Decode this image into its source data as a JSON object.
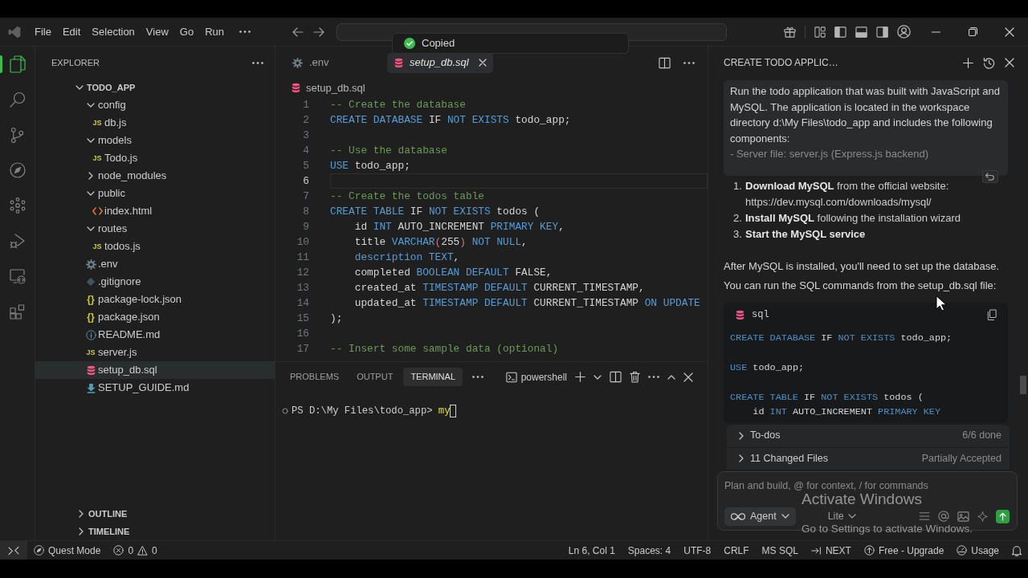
{
  "title_bar": {
    "menus": [
      "File",
      "Edit",
      "Selection",
      "View",
      "Go",
      "Run"
    ],
    "toast": "Copied"
  },
  "activity_bar": [
    {
      "selected": true
    },
    {
      "selected": false
    },
    {
      "selected": false
    },
    {
      "selected": false
    },
    {
      "selected": false
    },
    {
      "selected": false
    },
    {
      "selected": false
    },
    {
      "selected": false
    }
  ],
  "explorer": {
    "title": "EXPLORER",
    "tree": {
      "label": "TODO_APP",
      "expanded": true,
      "children": [
        {
          "label": "config",
          "kind": "folder",
          "expanded": true,
          "selected": false,
          "children": [
            {
              "label": "db.js",
              "kind": "javascript",
              "badge": "JS",
              "selected": false
            }
          ]
        },
        {
          "label": "models",
          "kind": "folder",
          "expanded": true,
          "selected": false,
          "children": [
            {
              "label": "Todo.js",
              "kind": "javascript",
              "badge": "JS",
              "selected": false
            }
          ]
        },
        {
          "label": "node_modules",
          "kind": "folder",
          "expanded": false,
          "selected": false
        },
        {
          "label": "public",
          "kind": "folder",
          "expanded": true,
          "selected": false,
          "children": [
            {
              "label": "index.html",
              "kind": "html",
              "selected": false
            }
          ]
        },
        {
          "label": "routes",
          "kind": "folder",
          "expanded": true,
          "selected": false,
          "children": [
            {
              "label": "todos.js",
              "kind": "javascript",
              "badge": "JS",
              "selected": false
            }
          ]
        },
        {
          "label": ".env",
          "kind": "env",
          "selected": false
        },
        {
          "label": ".gitignore",
          "kind": "gitignore",
          "selected": false
        },
        {
          "label": "package-lock.json",
          "kind": "json",
          "badge": "{}",
          "selected": false
        },
        {
          "label": "package.json",
          "kind": "json",
          "badge": "{}",
          "selected": false
        },
        {
          "label": "README.md",
          "kind": "readme",
          "selected": false
        },
        {
          "label": "server.js",
          "kind": "javascript",
          "badge": "JS",
          "selected": false
        },
        {
          "label": "setup_db.sql",
          "kind": "sql",
          "selected": true
        },
        {
          "label": "SETUP_GUIDE.md",
          "kind": "markdown",
          "selected": false
        }
      ]
    },
    "sections": [
      {
        "label": "OUTLINE",
        "expanded": false
      },
      {
        "label": "TIMELINE",
        "expanded": false
      }
    ]
  },
  "editor": {
    "tabs": [
      {
        "label": ".env",
        "kind": "env",
        "selected": false,
        "preview": false
      },
      {
        "label": "setup_db.sql",
        "kind": "sql",
        "selected": true,
        "preview": true
      }
    ],
    "breadcrumb": "setup_db.sql",
    "lines": [
      {
        "number": "1",
        "current": false,
        "tokens": [
          {
            "kind": "comment",
            "text": "-- Create the database"
          }
        ]
      },
      {
        "number": "2",
        "current": false,
        "tokens": [
          {
            "kind": "keyword",
            "text": "CREATE DATABASE"
          },
          {
            "kind": "plain",
            "text": " IF "
          },
          {
            "kind": "keyword",
            "text": "NOT EXISTS"
          },
          {
            "kind": "plain",
            "text": " todo_app;"
          }
        ]
      },
      {
        "number": "3",
        "current": false
      },
      {
        "number": "4",
        "current": false,
        "tokens": [
          {
            "kind": "comment",
            "text": "-- Use the database"
          }
        ]
      },
      {
        "number": "5",
        "current": false,
        "tokens": [
          {
            "kind": "keyword",
            "text": "USE"
          },
          {
            "kind": "plain",
            "text": " todo_app;"
          }
        ]
      },
      {
        "number": "6",
        "current": true
      },
      {
        "number": "7",
        "current": false,
        "tokens": [
          {
            "kind": "comment",
            "text": "-- Create the todos table"
          }
        ]
      },
      {
        "number": "8",
        "current": false,
        "tokens": [
          {
            "kind": "keyword",
            "text": "CREATE TABLE"
          },
          {
            "kind": "plain",
            "text": " IF "
          },
          {
            "kind": "keyword",
            "text": "NOT EXISTS"
          },
          {
            "kind": "plain",
            "text": " todos ("
          }
        ]
      },
      {
        "number": "9",
        "current": false,
        "tokens": [
          {
            "kind": "plain",
            "text": "    id "
          },
          {
            "kind": "keyword",
            "text": "INT"
          },
          {
            "kind": "plain",
            "text": " AUTO_INCREMENT "
          },
          {
            "kind": "keyword",
            "text": "PRIMARY KEY"
          },
          {
            "kind": "plain",
            "text": ","
          }
        ]
      },
      {
        "number": "10",
        "current": false,
        "tokens": [
          {
            "kind": "plain",
            "text": "    title "
          },
          {
            "kind": "keyword",
            "text": "VARCHAR"
          },
          {
            "kind": "bracket",
            "text": "("
          },
          {
            "kind": "plain",
            "text": "255"
          },
          {
            "kind": "bracket",
            "text": ")"
          },
          {
            "kind": "keyword",
            "text": " NOT NULL"
          },
          {
            "kind": "plain",
            "text": ","
          }
        ]
      },
      {
        "number": "11",
        "current": false,
        "tokens": [
          {
            "kind": "keyword",
            "text": "    description TEXT"
          },
          {
            "kind": "plain",
            "text": ","
          }
        ]
      },
      {
        "number": "12",
        "current": false,
        "tokens": [
          {
            "kind": "plain",
            "text": "    completed "
          },
          {
            "kind": "keyword",
            "text": "BOOLEAN DEFAULT"
          },
          {
            "kind": "plain",
            "text": " FALSE,"
          }
        ]
      },
      {
        "number": "13",
        "current": false,
        "tokens": [
          {
            "kind": "plain",
            "text": "    created_at "
          },
          {
            "kind": "keyword",
            "text": "TIMESTAMP DEFAULT"
          },
          {
            "kind": "plain",
            "text": " CURRENT_TIMESTAMP,"
          }
        ]
      },
      {
        "number": "14",
        "current": false,
        "tokens": [
          {
            "kind": "plain",
            "text": "    updated_at "
          },
          {
            "kind": "keyword",
            "text": "TIMESTAMP DEFAULT"
          },
          {
            "kind": "plain",
            "text": " CURRENT_TIMESTAMP "
          },
          {
            "kind": "keyword",
            "text": "ON UPDATE"
          }
        ]
      },
      {
        "number": "15",
        "current": false,
        "tokens": [
          {
            "kind": "plain",
            "text": ");"
          }
        ]
      },
      {
        "number": "16",
        "current": false
      },
      {
        "number": "17",
        "current": false,
        "tokens": [
          {
            "kind": "comment",
            "text": "-- Insert some sample data (optional)"
          }
        ]
      }
    ]
  },
  "panel": {
    "tabs": [
      {
        "label": "PROBLEMS",
        "selected": false
      },
      {
        "label": "OUTPUT",
        "selected": false
      },
      {
        "label": "TERMINAL",
        "selected": true
      }
    ],
    "shell": "powershell",
    "prompt": "PS D:\\My Files\\todo_app> ",
    "input": "my"
  },
  "chat": {
    "title": "CREATE TODO APPLIC…",
    "message": {
      "text": "Run the todo application that was built with JavaScript and MySQL. The application is located in the workspace directory d:\\My Files\\todo_app and includes the following components:",
      "excerpt": "- Server file: server.js (Express.js backend)"
    },
    "steps": [
      {
        "number": "1.",
        "text": "**Download MySQL** from the official website: https://dev.mysql.com/downloads/mysql/",
        "bold": false
      },
      {
        "number": "2.",
        "text": "**Install MySQL** following the installation wizard",
        "bold": false
      },
      {
        "number": "3.",
        "text": "Start the MySQL service",
        "bold": true
      }
    ],
    "paragraph": "After MySQL is installed, you'll need to set up the database. You can run the SQL commands from the setup_db.sql file:",
    "code_block": {
      "language": "sql",
      "lines": [
        {
          "blank_before": false,
          "tokens": [
            {
              "kind": "keyword",
              "text": "CREATE DATABASE"
            },
            {
              "kind": "plain",
              "text": " IF "
            },
            {
              "kind": "keyword",
              "text": "NOT EXISTS"
            },
            {
              "kind": "plain",
              "text": " todo_app;"
            }
          ]
        },
        {
          "blank_before": true,
          "tokens": [
            {
              "kind": "keyword",
              "text": "USE"
            },
            {
              "kind": "plain",
              "text": " todo_app;"
            }
          ]
        },
        {
          "blank_before": true,
          "tokens": [
            {
              "kind": "keyword",
              "text": "CREATE TABLE"
            },
            {
              "kind": "plain",
              "text": " IF "
            },
            {
              "kind": "keyword",
              "text": "NOT EXISTS"
            },
            {
              "kind": "plain",
              "text": " todos ("
            }
          ]
        },
        {
          "blank_before": false,
          "tokens": [
            {
              "kind": "plain",
              "text": "    id "
            },
            {
              "kind": "keyword",
              "text": "INT"
            },
            {
              "kind": "plain",
              "text": " AUTO_INCREMENT "
            },
            {
              "kind": "keyword",
              "text": "PRIMARY KEY"
            }
          ]
        }
      ]
    },
    "summaries": [
      {
        "label": "To-dos",
        "status": "6/6 done",
        "expanded": false
      },
      {
        "label": "11 Changed Files",
        "status": "Partially Accepted",
        "expanded": false
      }
    ],
    "composer": {
      "placeholder": "Plan and build, @ for context, / for commands",
      "mode": "Agent",
      "model": "Lite"
    }
  },
  "status_bar": {
    "mode": "Quest Mode",
    "errors": "0",
    "warnings": "0",
    "position": "Ln 6, Col 1",
    "indentation": "Spaces: 4",
    "encoding": "UTF-8",
    "line_ending": "CRLF",
    "language": "MS SQL",
    "next": "NEXT",
    "plan": "Free - Upgrade",
    "usage": "Usage"
  },
  "activation_notice": {
    "title": "Activate Windows",
    "detail": "Go to Settings to activate Windows."
  }
}
